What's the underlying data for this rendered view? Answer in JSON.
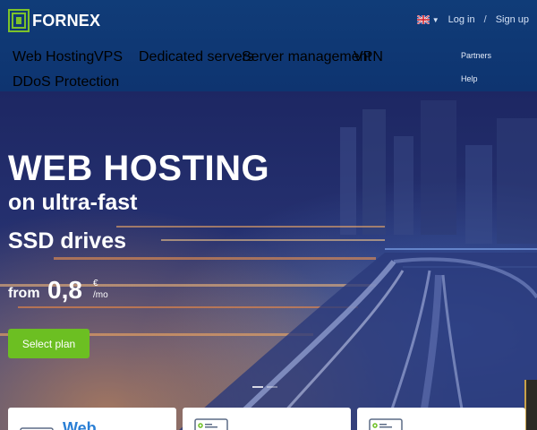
{
  "brand": {
    "name": "FORNEX",
    "accent": "#7cc22a"
  },
  "header": {
    "language_icon": "uk-flag-icon",
    "login_label": "Log in",
    "separator": "/",
    "signup_label": "Sign up"
  },
  "nav": {
    "items": [
      "Web Hosting",
      "VPS",
      "Dedicated servers",
      "Server management",
      "VPN",
      "DDoS Protection"
    ],
    "right": [
      "Partners",
      "Help"
    ]
  },
  "hero": {
    "title": "WEB HOSTING",
    "line1": "on ultra-fast",
    "line2": "SSD drives",
    "price_prefix": "from",
    "price_value": "0,8",
    "price_currency": "€",
    "price_period": "/mo",
    "cta_label": "Select plan",
    "cta_color": "#6cbf22"
  },
  "cards": [
    {
      "title": "Web",
      "icon": "hosting-icon"
    },
    {
      "title": "",
      "icon": "server-icon"
    },
    {
      "title": "",
      "icon": "server-icon"
    }
  ]
}
